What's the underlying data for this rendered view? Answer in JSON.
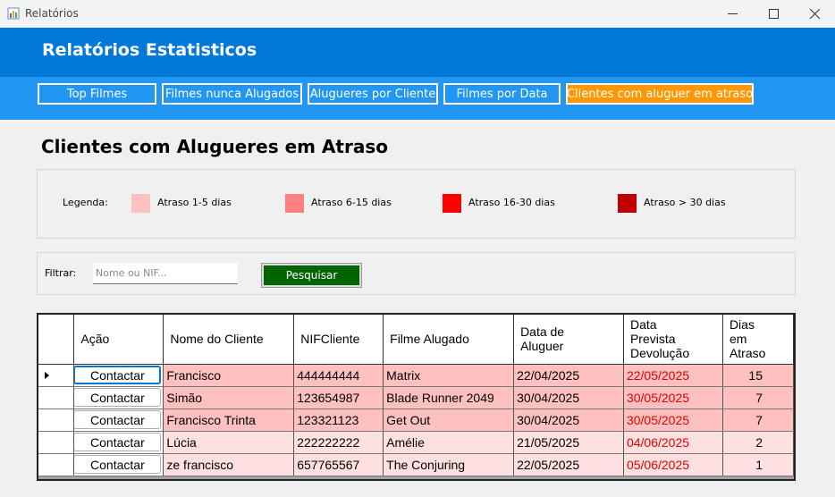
{
  "window": {
    "title": "Relatórios",
    "icon": "chart-icon"
  },
  "header": {
    "title": "Relatórios Estatisticos"
  },
  "nav": {
    "buttons": [
      {
        "label": "Top Filmes",
        "active": false
      },
      {
        "label": "Filmes nunca Alugados",
        "active": false
      },
      {
        "label": "Alugueres por Cliente",
        "active": false
      },
      {
        "label": "Filmes por Data",
        "active": false
      },
      {
        "label": "Clientes com aluguer em atraso",
        "active": true
      }
    ]
  },
  "section": {
    "title": "Clientes com Alugueres em Atraso"
  },
  "legend": {
    "label": "Legenda:",
    "items": [
      {
        "text": "Atraso 1-5 dias",
        "color": "#ffc0c0"
      },
      {
        "text": "Atraso 6-15 dias",
        "color": "#ff8080"
      },
      {
        "text": "Atraso 16-30 dias",
        "color": "#ff0000"
      },
      {
        "text": "Atraso > 30 dias",
        "color": "#c00000"
      }
    ]
  },
  "filter": {
    "label": "Filtrar:",
    "placeholder": "Nome ou NIF...",
    "value": "",
    "search_label": "Pesquisar"
  },
  "table": {
    "columns": [
      "Ação",
      "Nome do Cliente",
      "NIFCliente",
      "Filme Alugado",
      "Data de Aluguer",
      "Data Prevista Devolução",
      "Dias em Atraso"
    ],
    "rows": [
      {
        "action": "Contactar",
        "nome": "Francisco",
        "nif": "444444444",
        "filme": "Matrix",
        "data_aluguer": "22/04/2025",
        "data_prevista": "22/05/2025",
        "dias": "15",
        "row_color": "#ffc0c0"
      },
      {
        "action": "Contactar",
        "nome": "Simão",
        "nif": "123654987",
        "filme": "Blade Runner 2049",
        "data_aluguer": "30/04/2025",
        "data_prevista": "30/05/2025",
        "dias": "7",
        "row_color": "#ffc0c0"
      },
      {
        "action": "Contactar",
        "nome": "Francisco Trinta",
        "nif": "123321123",
        "filme": "Get Out",
        "data_aluguer": "30/04/2025",
        "data_prevista": "30/05/2025",
        "dias": "7",
        "row_color": "#ffc0c0"
      },
      {
        "action": "Contactar",
        "nome": "Lúcia",
        "nif": "222222222",
        "filme": "Amélie",
        "data_aluguer": "21/05/2025",
        "data_prevista": "04/06/2025",
        "dias": "2",
        "row_color": "#ffe0e0"
      },
      {
        "action": "Contactar",
        "nome": "ze francisco",
        "nif": "657765567",
        "filme": "The Conjuring",
        "data_aluguer": "22/05/2025",
        "data_prevista": "05/06/2025",
        "dias": "1",
        "row_color": "#ffe0e0"
      }
    ]
  },
  "colors": {
    "header_bg": "#0078d7",
    "nav_bg": "#2196f3",
    "active_nav": "#ff9800",
    "search_btn": "#006400",
    "overdue_date_text": "#e00000"
  }
}
